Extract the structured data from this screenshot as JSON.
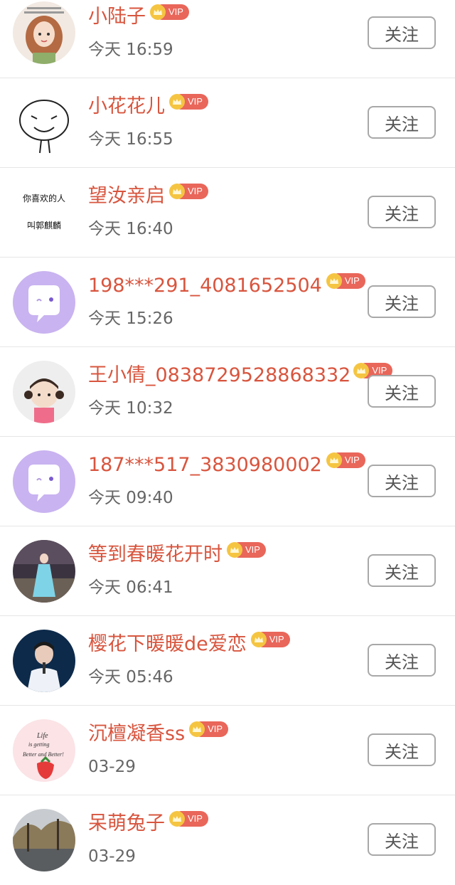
{
  "follow_label": "关注",
  "vip_label": "VIP",
  "users": [
    {
      "name": "小陆子",
      "time": "今天 16:59",
      "avatar": "girl-illustration-avatar"
    },
    {
      "name": "小花花儿",
      "time": "今天 16:55",
      "avatar": "doodle-face-avatar"
    },
    {
      "name": "望汝亲启",
      "time": "今天 16:40",
      "avatar": "calligraphy-text-avatar",
      "avatar_text_1": "你喜欢的人",
      "avatar_text_2": "叫郭麒麟"
    },
    {
      "name": "198***291_4081652504",
      "time": "今天 15:26",
      "avatar": "default-chat-avatar"
    },
    {
      "name": "王小倩_0838729528868332",
      "time": "今天 10:32",
      "avatar": "cartoon-girl-avatar"
    },
    {
      "name": "187***517_3830980002",
      "time": "今天 09:40",
      "avatar": "default-chat-avatar"
    },
    {
      "name": "等到春暖花开时",
      "time": "今天 06:41",
      "avatar": "costume-photo-avatar"
    },
    {
      "name": "樱花下暖暖de爱恋",
      "time": "今天 05:46",
      "avatar": "singer-photo-avatar"
    },
    {
      "name": "沉檀凝香ss",
      "time": "03-29",
      "avatar": "strawberry-text-avatar",
      "avatar_text_1": "Life",
      "avatar_text_2": "is getting",
      "avatar_text_3": "Better and Better!"
    },
    {
      "name": "呆萌兔子",
      "time": "03-29",
      "avatar": "street-photo-avatar"
    }
  ],
  "colors": {
    "name": "#d8553e",
    "time": "#666666",
    "vip_bg": "#e9665a",
    "crown": "#f5c542",
    "default_avatar_bg": "#c9b3f0"
  }
}
